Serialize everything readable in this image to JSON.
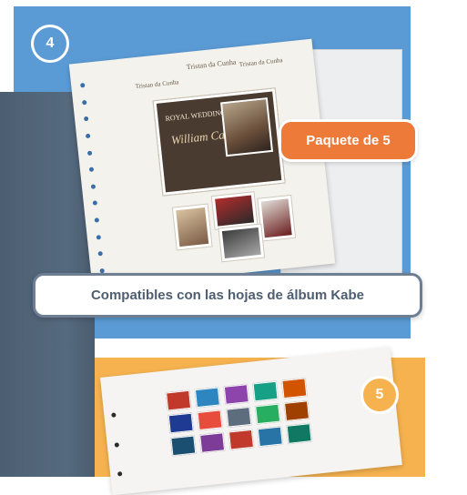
{
  "badges": {
    "step_four": "4",
    "step_five": "5"
  },
  "pack_label": "Paquete de 5",
  "compat_label": "Compatibles con las hojas de álbum Kabe",
  "album_sheet": {
    "title_center": "Tristan da Cunha",
    "title_left": "Tristan da Cunha",
    "title_right": "Tristan da Cunha",
    "block_heading": "ROYAL WEDDING",
    "block_names": "William Catherine"
  },
  "colors": {
    "panel_blue": "#5b9bd5",
    "panel_orange": "#f6b24f",
    "pill_orange": "#ee7a3a",
    "pill_border": "#6e7f93"
  },
  "stamp_colors": [
    "#c0392b",
    "#2e86c1",
    "#8e44ad",
    "#16a085",
    "#d35400",
    "#1f3a93",
    "#e74c3c",
    "#5d6d7e",
    "#27ae60",
    "#a04000",
    "#1b4f72",
    "#7d3c98",
    "#c0392b",
    "#2874a6",
    "#117864"
  ]
}
